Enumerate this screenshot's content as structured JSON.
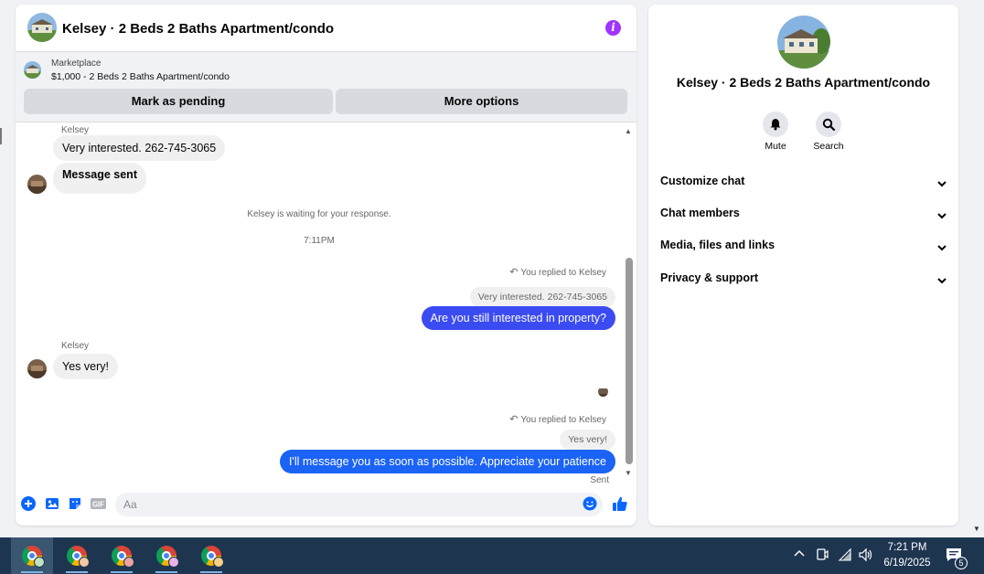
{
  "chat": {
    "title": "Kelsey · 2 Beds 2 Baths Apartment/condo",
    "marketplace": {
      "label": "Marketplace",
      "listing": "$1,000 - 2 Beds 2 Baths Apartment/condo",
      "pending_button": "Mark as pending",
      "options_button": "More options"
    },
    "messages": {
      "sender1": "Kelsey",
      "msg1": "Very interested. 262-745-3065",
      "msg2": "Message sent",
      "waiting_note": "Kelsey is waiting for your response.",
      "timestamp": "7:11PM",
      "reply1_label": "You replied to Kelsey",
      "reply1_quote": "Very interested. 262-745-3065",
      "out1": "Are you still interested in property?",
      "sender2": "Kelsey",
      "msg3": "Yes very!",
      "reply2_label": "You replied to Kelsey",
      "reply2_quote": "Yes very!",
      "out2": "I'll message you as soon as possible. Appreciate your patience",
      "status": "Sent"
    },
    "composer": {
      "placeholder": "Aa"
    }
  },
  "right_panel": {
    "title": "Kelsey · 2 Beds 2 Baths Apartment/condo",
    "actions": {
      "mute": "Mute",
      "search": "Search"
    },
    "sections": {
      "customize": "Customize chat",
      "members": "Chat members",
      "media": "Media, files and links",
      "privacy": "Privacy & support"
    }
  },
  "taskbar": {
    "time": "7:21 PM",
    "date": "6/19/2025",
    "notification_count": "5"
  },
  "colors": {
    "outgoing_bubble_1": "#3b4bf2",
    "outgoing_bubble_2": "#1b63f5",
    "accent_blue": "#0866ff",
    "info_purple": "#a033ff",
    "taskbar": "#1e3550"
  }
}
